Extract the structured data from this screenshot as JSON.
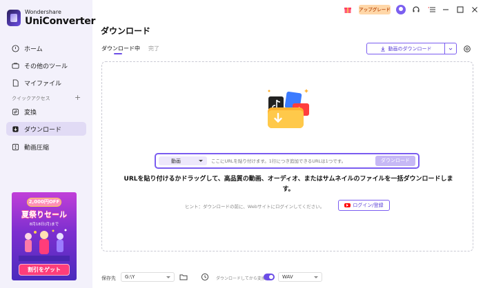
{
  "app": {
    "brand": "Wondershare",
    "name": "UniConverter"
  },
  "topbar": {
    "upgrade_label": "アップグレード",
    "icons": [
      "gift-icon",
      "avatar",
      "headset-icon",
      "menu-icon",
      "minimize-icon",
      "maximize-icon",
      "close-icon"
    ]
  },
  "sidebar": {
    "items": [
      {
        "label": "ホーム",
        "icon": "home-icon"
      },
      {
        "label": "その他のツール",
        "icon": "toolbox-icon"
      },
      {
        "label": "マイファイル",
        "icon": "file-icon"
      },
      {
        "label": "変換",
        "icon": "convert-icon"
      },
      {
        "label": "ダウンロード",
        "icon": "download-icon",
        "active": true
      },
      {
        "label": "動画圧縮",
        "icon": "compress-icon"
      }
    ],
    "section_label": "クイックアクセス",
    "section_add": "+"
  },
  "promo": {
    "pill": "2,000円OFF",
    "title": "夏祭りセール",
    "date": "8月18日(月)まで",
    "button": "割引をゲット"
  },
  "main": {
    "title": "ダウンロード",
    "tabs": [
      {
        "label": "ダウンロード中",
        "active": true
      },
      {
        "label": "完了",
        "active": false
      }
    ],
    "download_video_button": "動画のダウンロード",
    "url_bar": {
      "type_selected": "動画",
      "placeholder": "ここにURLを貼り付けます。1行につき追加できるURLは1つです。",
      "download_button": "ダウンロード"
    },
    "headline": "URLを貼り付けるかドラッグして、高品質の動画、オーディオ、またはサムネイルのファイルを一括ダウンロードします。",
    "hint": "ヒント：ダウンロードの前に、Webサイトにログインしてください。",
    "login_button": "ログイン/登録"
  },
  "bottombar": {
    "save_label": "保存先",
    "save_path": "G:\\Y",
    "convert_toggle_label": "ダウンロードしてから変換",
    "convert_toggle_on": true,
    "format": "WAV"
  },
  "colors": {
    "accent": "#6b4de6",
    "sidebar_bg": "#f3f1fb",
    "sidebar_active": "#e1dbf5",
    "upgrade_bg": "#ffd7a8"
  }
}
